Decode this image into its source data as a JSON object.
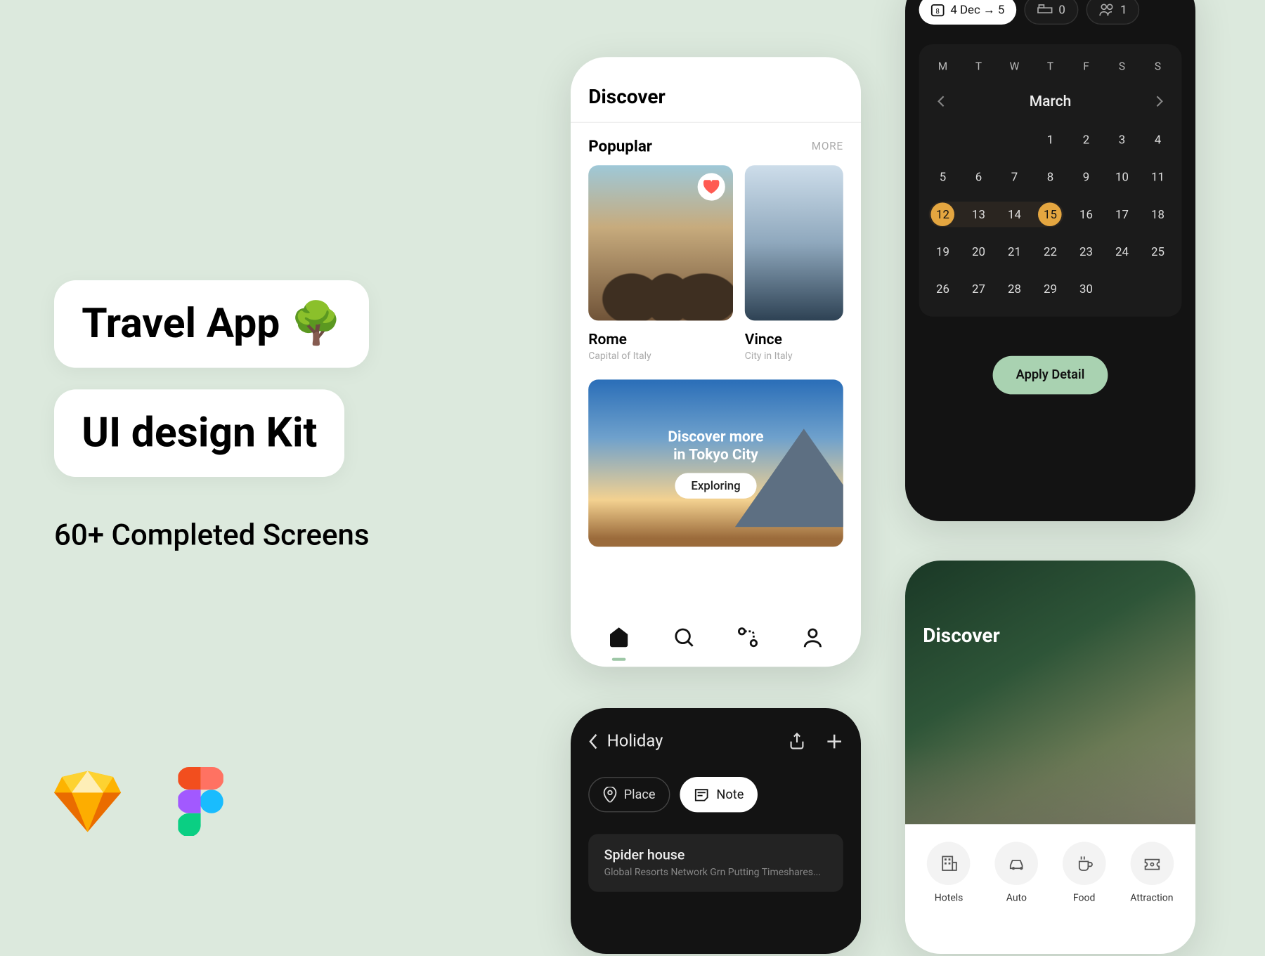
{
  "left": {
    "title1": "Travel App 🌳",
    "title2": "UI design Kit",
    "subhead": "60+ Completed Screens"
  },
  "discoverScreen": {
    "title": "Discover",
    "popularHeading": "Popuplar",
    "moreLabel": "MORE",
    "cards": [
      {
        "name": "Rome",
        "caption": "Capital of Italy"
      },
      {
        "name": "Vince",
        "caption": "City in Italy"
      }
    ],
    "banner": {
      "line1": "Discover more",
      "line2": "in Tokyo City",
      "button": "Exploring"
    }
  },
  "calendarScreen": {
    "dateChip": "4 Dec → 5",
    "bedCount": "0",
    "peopleCount": "1",
    "dow": [
      "M",
      "T",
      "W",
      "T",
      "F",
      "S",
      "S"
    ],
    "month": "March",
    "days": [
      "",
      "",
      "",
      "1",
      "2",
      "3",
      "4",
      "5",
      "6",
      "7",
      "8",
      "9",
      "10",
      "11",
      "12",
      "13",
      "14",
      "15",
      "16",
      "17",
      "18",
      "19",
      "20",
      "21",
      "22",
      "23",
      "24",
      "25",
      "26",
      "27",
      "28",
      "29",
      "30"
    ],
    "selectStart": "12",
    "selectEnd": "15",
    "applyLabel": "Apply Detail"
  },
  "holidayScreen": {
    "title": "Holiday",
    "pills": {
      "place": "Place",
      "note": "Note"
    },
    "item": {
      "name": "Spider house",
      "sub": "Global Resorts Network Grn Putting Timeshares..."
    }
  },
  "categoryScreen": {
    "title": "Discover",
    "cats": [
      {
        "label": "Hotels",
        "icon": "building-icon"
      },
      {
        "label": "Auto",
        "icon": "car-icon"
      },
      {
        "label": "Food",
        "icon": "cup-icon"
      },
      {
        "label": "Attraction",
        "icon": "ticket-icon"
      }
    ]
  }
}
